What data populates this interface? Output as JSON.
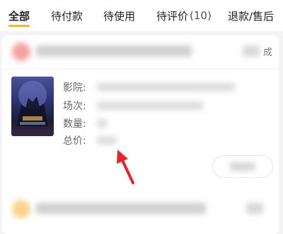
{
  "tabs": [
    {
      "label": "全部",
      "count": ""
    },
    {
      "label": "待付款",
      "count": ""
    },
    {
      "label": "待使用",
      "count": ""
    },
    {
      "label": "待评价",
      "count": "(10)"
    },
    {
      "label": "退款/售后",
      "count": ""
    }
  ],
  "order1": {
    "status": "成",
    "fields": {
      "cinema_label": "影院:",
      "session_label": "场次:",
      "quantity_label": "数量:",
      "total_label": "总价:"
    }
  },
  "colors": {
    "accent": "#f2b632",
    "arrow": "#e0262b"
  }
}
